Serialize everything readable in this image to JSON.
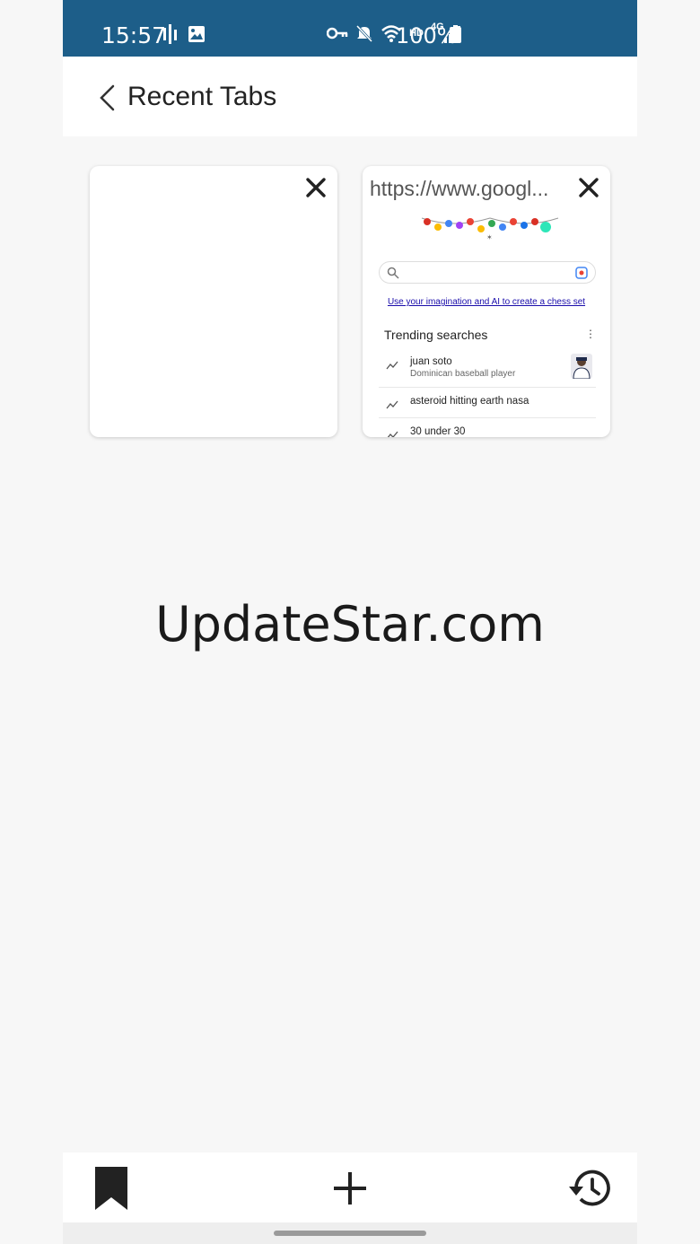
{
  "status_bar": {
    "time": "15:57",
    "network_label": "HD",
    "network_type": "4G",
    "battery": "100%",
    "background_color": "#1d5e89"
  },
  "header": {
    "title": "Recent Tabs",
    "back_icon": "chevron-left-icon"
  },
  "tabs": [
    {
      "url": "",
      "blank": true
    },
    {
      "url": "https://www.googl...",
      "page": {
        "promo_link": "Use your imagination and AI to create a chess set",
        "trending_title": "Trending searches",
        "trending": [
          {
            "title": "juan soto",
            "subtitle": "Dominican baseball player"
          },
          {
            "title": "asteroid hitting earth nasa",
            "subtitle": ""
          },
          {
            "title": "30 under 30",
            "subtitle": ""
          }
        ]
      }
    }
  ],
  "watermark": "UpdateStar.com",
  "bottom_bar": {
    "bookmark_icon": "bookmark-icon",
    "new_tab_icon": "plus-icon",
    "history_icon": "history-icon"
  }
}
